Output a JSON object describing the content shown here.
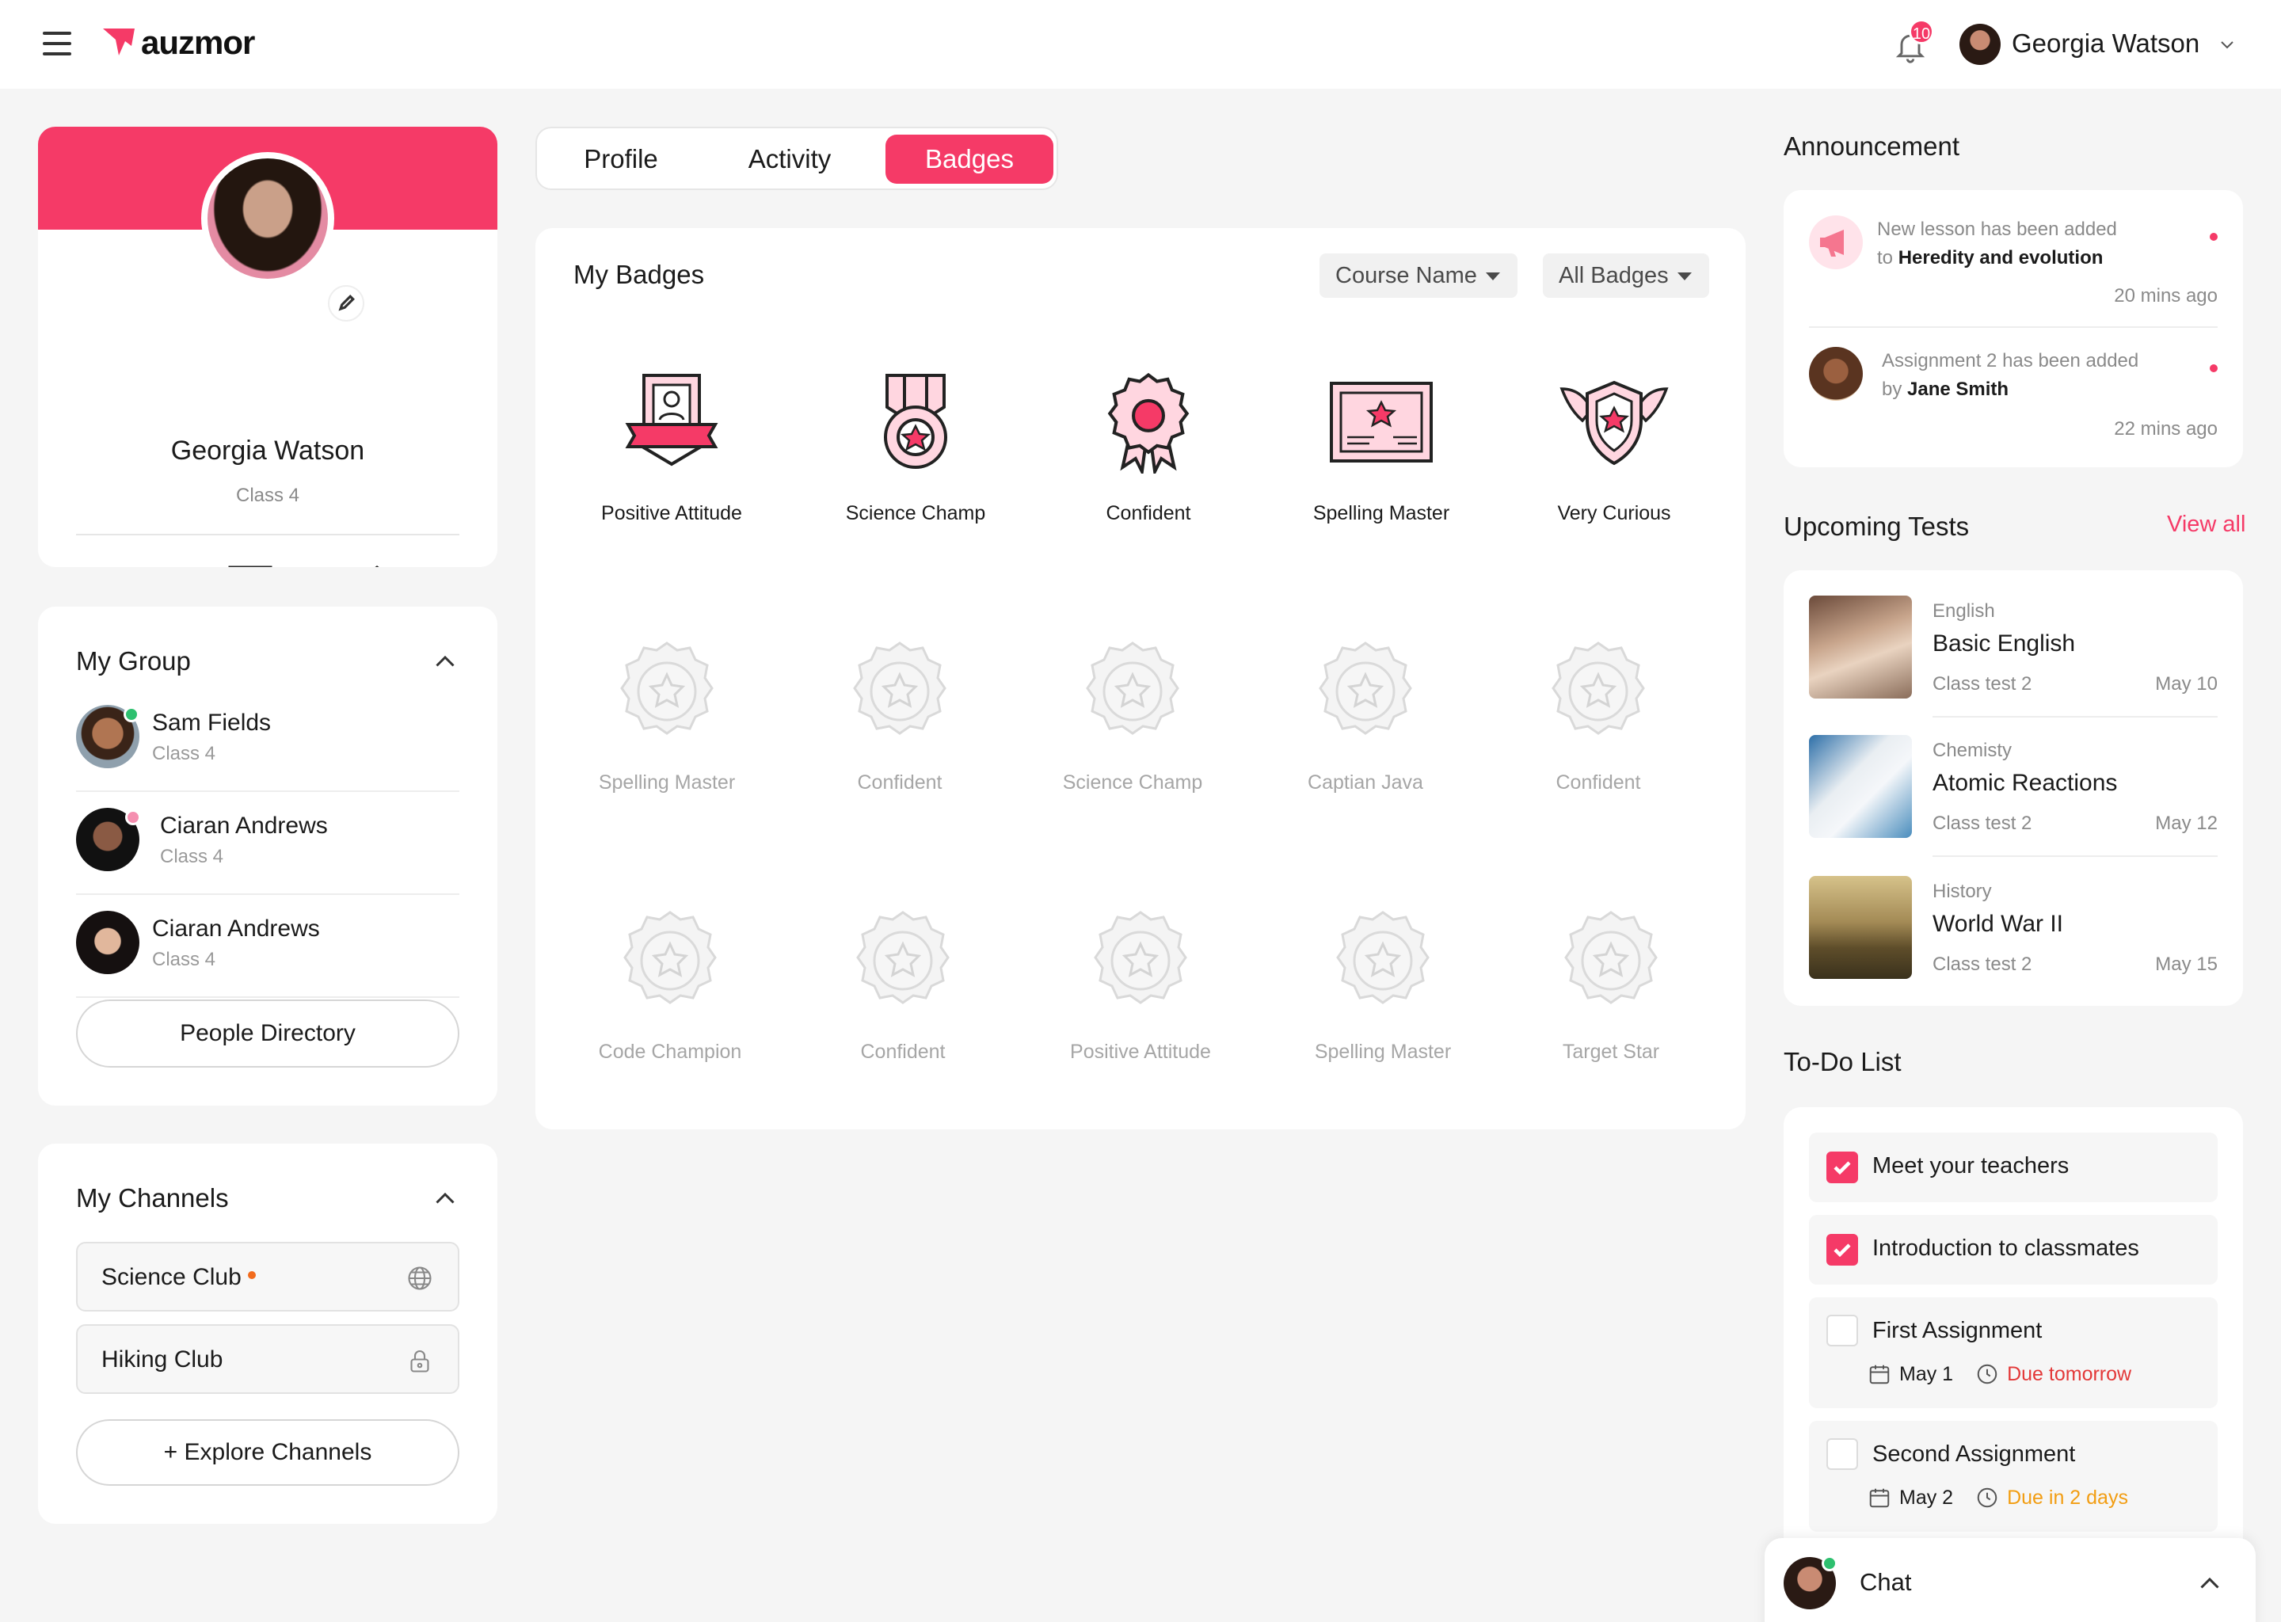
{
  "header": {
    "logo_text": "auzmor",
    "notification_count": "10",
    "user_name": "Georgia Watson"
  },
  "profile": {
    "name": "Georgia Watson",
    "class": "Class 4"
  },
  "tabs": [
    {
      "label": "Profile"
    },
    {
      "label": "Activity"
    },
    {
      "label": "Badges"
    }
  ],
  "active_tab": "Badges",
  "my_group": {
    "title": "My Group",
    "members": [
      {
        "name": "Sam Fields",
        "class": "Class 4",
        "status": "online"
      },
      {
        "name": "Ciaran Andrews",
        "class": "Class 4",
        "status": "away"
      },
      {
        "name": "Ciaran Andrews",
        "class": "Class 4",
        "status": ""
      }
    ],
    "button": "People Directory"
  },
  "my_channels": {
    "title": "My Channels",
    "channels": [
      {
        "name": "Science Club",
        "icon": "globe-icon"
      },
      {
        "name": "Hiking Club",
        "icon": "lock-icon"
      }
    ],
    "button": "+ Explore Channels"
  },
  "badges": {
    "title": "My Badges",
    "filter_course": "Course Name",
    "filter_badges": "All Badges",
    "earned": [
      {
        "label": "Positive Attitude",
        "icon": "certificate-badge-icon"
      },
      {
        "label": "Science Champ",
        "icon": "medal-star-icon"
      },
      {
        "label": "Confident",
        "icon": "rosette-icon"
      },
      {
        "label": "Spelling Master",
        "icon": "diploma-icon"
      },
      {
        "label": "Very Curious",
        "icon": "winged-shield-icon"
      }
    ],
    "locked_row1": [
      {
        "label": "Spelling Master"
      },
      {
        "label": "Confident"
      },
      {
        "label": "Science Champ"
      },
      {
        "label": "Captian Java"
      },
      {
        "label": "Confident"
      }
    ],
    "locked_row2": [
      {
        "label": "Code Champion"
      },
      {
        "label": "Confident"
      },
      {
        "label": "Positive Attitude"
      },
      {
        "label": "Spelling Master"
      },
      {
        "label": "Target Star"
      }
    ]
  },
  "announcement": {
    "title": "Announcement",
    "items": [
      {
        "prefix": "New lesson has been added",
        "mid": "to",
        "bold": "Heredity and evolution",
        "time": "20 mins ago"
      },
      {
        "prefix": "Assignment 2 has been added",
        "mid": "by",
        "bold": "Jane Smith",
        "time": "22 mins ago"
      }
    ]
  },
  "upcoming_tests": {
    "title": "Upcoming Tests",
    "view_all": "View all",
    "items": [
      {
        "subject": "English",
        "title": "Basic English",
        "sub": "Class test 2",
        "date": "May 10"
      },
      {
        "subject": "Chemisty",
        "title": "Atomic Reactions",
        "sub": "Class test 2",
        "date": "May 12"
      },
      {
        "subject": "History",
        "title": "World War II",
        "sub": "Class test 2",
        "date": "May 15"
      }
    ]
  },
  "todo": {
    "title": "To-Do List",
    "items": [
      {
        "label": "Meet your teachers",
        "checked": true
      },
      {
        "label": "Introduction to classmates",
        "checked": true
      },
      {
        "label": "First Assignment",
        "checked": false,
        "date": "May 1",
        "due": "Due tomorrow"
      },
      {
        "label": "Second Assignment",
        "checked": false,
        "date": "May 2",
        "due": "Due in 2 days"
      }
    ]
  },
  "chat": {
    "label": "Chat"
  },
  "colors": {
    "accent": "#f53a67",
    "online": "#2ec06f",
    "due_red": "#e33838",
    "due_orange": "#f29d12"
  }
}
